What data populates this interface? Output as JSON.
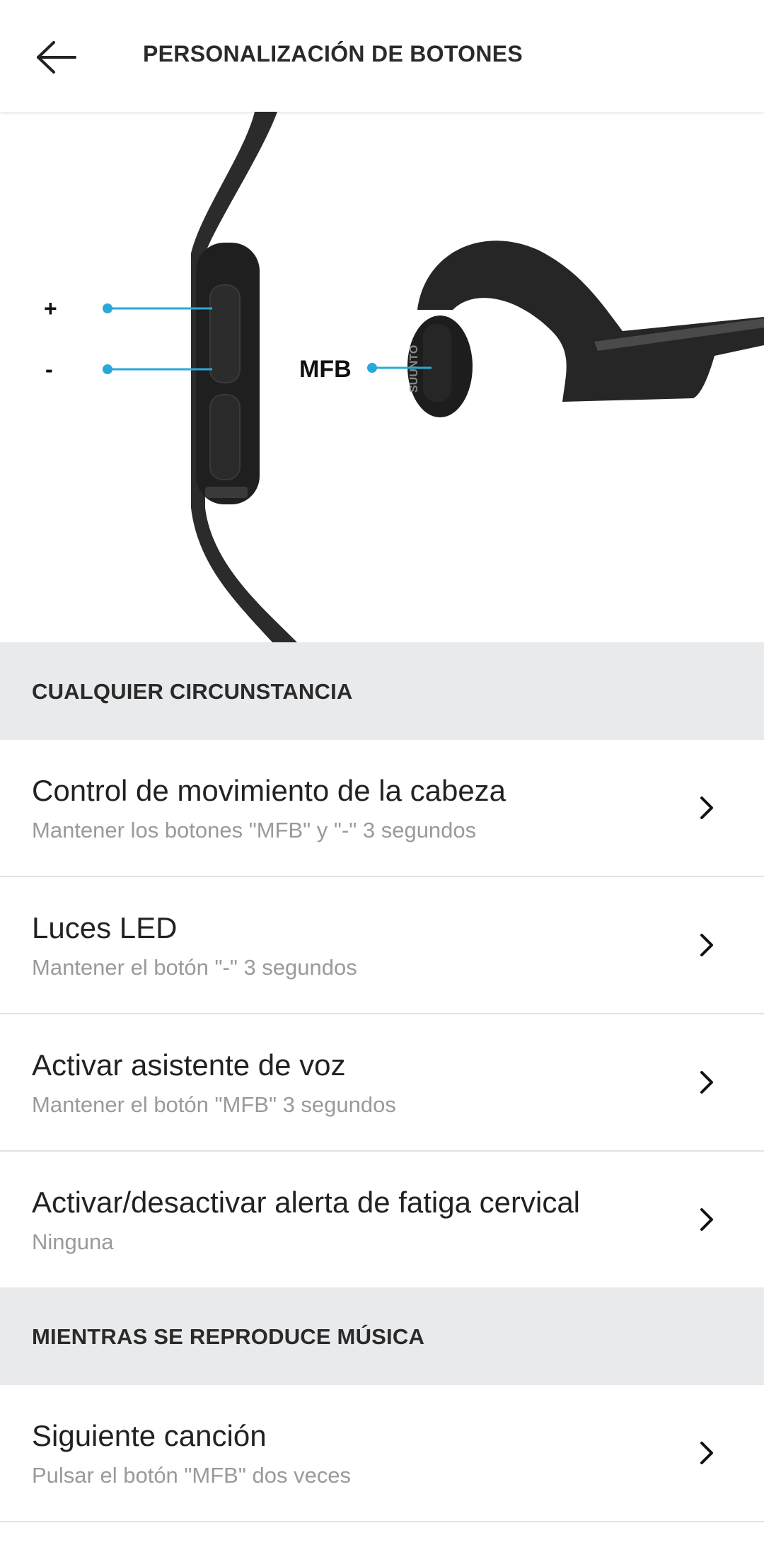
{
  "header": {
    "back_icon": "arrow-left-icon",
    "title": "PERSONALIZACIÓN DE BOTONES"
  },
  "hero": {
    "labels": {
      "plus": "+",
      "minus": "-",
      "mfb": "MFB",
      "brand": "SUUNTO"
    },
    "accent_color": "#29a9d8"
  },
  "sections": [
    {
      "header": "CUALQUIER CIRCUNSTANCIA",
      "items": [
        {
          "title": "Control de movimiento de la cabeza",
          "subtitle": "Mantener los botones \"MFB\" y \"-\" 3 segundos"
        },
        {
          "title": "Luces LED",
          "subtitle": "Mantener el botón \"-\" 3 segundos"
        },
        {
          "title": "Activar asistente de voz",
          "subtitle": "Mantener el botón \"MFB\" 3 segundos"
        },
        {
          "title": "Activar/desactivar alerta de fatiga cervical",
          "subtitle": "Ninguna"
        }
      ]
    },
    {
      "header": "MIENTRAS SE REPRODUCE MÚSICA",
      "items": [
        {
          "title": "Siguiente canción",
          "subtitle": "Pulsar el botón \"MFB\" dos veces"
        }
      ]
    }
  ],
  "colors": {
    "section_bg": "#e8eaec",
    "subtitle": "#9a9a9a",
    "divider": "#e0e2e4"
  }
}
